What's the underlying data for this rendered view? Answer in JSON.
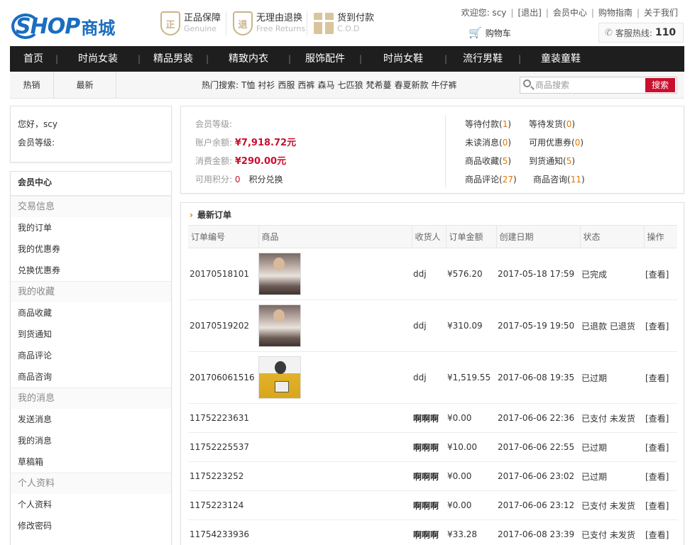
{
  "header": {
    "logo_text": "SHOP",
    "logo_cn": "商城",
    "badges": [
      {
        "icon": "shield-zheng-icon",
        "glyph": "正",
        "title": "正品保障",
        "sub": "Genuine"
      },
      {
        "icon": "shield-tui-icon",
        "glyph": "退",
        "title": "无理由退换",
        "sub": "Free Returns"
      },
      {
        "icon": "gift-icon",
        "title": "货到付款",
        "sub": "C.O.D"
      }
    ],
    "greeting": "欢迎您: scy",
    "logout": "[退出]",
    "member_center": "会员中心",
    "shopping_guide": "购物指南",
    "about": "关于我们",
    "cart": "购物车",
    "hotline_label": "客服热线:",
    "hotline_number": "110"
  },
  "nav": {
    "items": [
      "首页",
      "时尚女装",
      "精品男装",
      "精致内衣",
      "服饰配件",
      "时尚女鞋",
      "流行男鞋",
      "童装童鞋"
    ]
  },
  "subbar": {
    "tabs": [
      "热销",
      "最新"
    ],
    "hot_label": "热门搜索:",
    "hot_terms": [
      "T恤",
      "衬衫",
      "西服",
      "西裤",
      "森马",
      "七匹狼",
      "梵希蔓",
      "春夏新款",
      "牛仔裤"
    ],
    "search_placeholder": "商品搜索",
    "search_button": "搜索"
  },
  "userbox": {
    "hello": "您好，scy",
    "level_label": "会员等级:"
  },
  "menu": {
    "title": "会员中心",
    "groups": [
      {
        "label": "交易信息",
        "links": [
          "我的订单",
          "我的优惠券",
          "兑换优惠券"
        ]
      },
      {
        "label": "我的收藏",
        "links": [
          "商品收藏",
          "到货通知",
          "商品评论",
          "商品咨询"
        ]
      },
      {
        "label": "我的消息",
        "links": [
          "发送消息",
          "我的消息",
          "草稿箱"
        ]
      },
      {
        "label": "个人资料",
        "links": [
          "个人资料",
          "修改密码"
        ]
      }
    ]
  },
  "summary": {
    "level_label": "会员等级:",
    "balance_label": "账户余额:",
    "balance_value": "¥7,918.72元",
    "spent_label": "消费金额:",
    "spent_value": "¥290.00元",
    "points_label": "可用积分:",
    "points_value": "0",
    "points_exchange": "积分兑换",
    "stats": [
      {
        "label": "等待付款",
        "count": "1"
      },
      {
        "label": "等待发货",
        "count": "0"
      },
      {
        "label": "未读消息",
        "count": "0"
      },
      {
        "label": "可用优惠券",
        "count": "0"
      },
      {
        "label": "商品收藏",
        "count": "5"
      },
      {
        "label": "到货通知",
        "count": "5"
      },
      {
        "label": "商品评论",
        "count": "27"
      },
      {
        "label": "商品咨询",
        "count": "11"
      }
    ]
  },
  "orders": {
    "title": "最新订单",
    "columns": [
      "订单编号",
      "商品",
      "收货人",
      "订单金额",
      "创建日期",
      "状态",
      "操作"
    ],
    "rows": [
      {
        "id": "20170518101",
        "thumb": "a",
        "receiver": "ddj",
        "amount": "¥576.20",
        "date": "2017-05-18 17:59",
        "status": "已完成",
        "action": "[查看]"
      },
      {
        "id": "20170519202",
        "thumb": "a",
        "receiver": "ddj",
        "amount": "¥310.09",
        "date": "2017-05-19 19:50",
        "status": "已退款 已退货",
        "action": "[查看]"
      },
      {
        "id": "201706061516",
        "thumb": "b",
        "receiver": "ddj",
        "amount": "¥1,519.55",
        "date": "2017-06-08 19:35",
        "status": "已过期",
        "action": "[查看]"
      },
      {
        "id": "11752223631",
        "thumb": "",
        "receiver": "啊啊啊",
        "amount": "¥0.00",
        "date": "2017-06-06 22:36",
        "status": "已支付 未发货",
        "action": "[查看]"
      },
      {
        "id": "11752225537",
        "thumb": "",
        "receiver": "啊啊啊",
        "amount": "¥10.00",
        "date": "2017-06-06 22:55",
        "status": "已过期",
        "action": "[查看]"
      },
      {
        "id": "1175223252",
        "thumb": "",
        "receiver": "啊啊啊",
        "amount": "¥0.00",
        "date": "2017-06-06 23:02",
        "status": "已过期",
        "action": "[查看]"
      },
      {
        "id": "1175223124",
        "thumb": "",
        "receiver": "啊啊啊",
        "amount": "¥0.00",
        "date": "2017-06-06 23:12",
        "status": "已支付 未发货",
        "action": "[查看]"
      },
      {
        "id": "11754233936",
        "thumb": "",
        "receiver": "啊啊啊",
        "amount": "¥33.28",
        "date": "2017-06-08 23:39",
        "status": "已支付 未发货",
        "action": "[查看]"
      }
    ]
  }
}
